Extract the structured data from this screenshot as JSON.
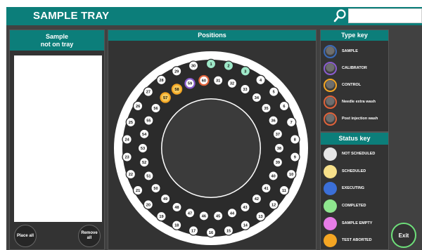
{
  "app": {
    "title": "SAMPLE TRAY"
  },
  "search": {
    "value": "",
    "placeholder": "",
    "icon": "search-icon"
  },
  "sample_panel": {
    "header": "Sample\nnot on tray",
    "place_all_label": "Place all",
    "remove_all_label": "Remove\nall"
  },
  "positions_panel": {
    "header": "Positions",
    "outer_ring": [
      {
        "label": "1",
        "status": "completed"
      },
      {
        "label": "2",
        "status": "completed"
      },
      {
        "label": "3",
        "status": "completed"
      },
      {
        "label": "4",
        "status": "not_scheduled"
      },
      {
        "label": "5",
        "status": "not_scheduled"
      },
      {
        "label": "6",
        "status": "not_scheduled"
      },
      {
        "label": "7",
        "status": "not_scheduled"
      },
      {
        "label": "8",
        "status": "not_scheduled"
      },
      {
        "label": "9",
        "status": "not_scheduled"
      },
      {
        "label": "10",
        "status": "not_scheduled"
      },
      {
        "label": "11",
        "status": "not_scheduled"
      },
      {
        "label": "12",
        "status": "not_scheduled"
      },
      {
        "label": "13",
        "status": "not_scheduled"
      },
      {
        "label": "14",
        "status": "not_scheduled"
      },
      {
        "label": "15",
        "status": "not_scheduled"
      },
      {
        "label": "16",
        "status": "not_scheduled"
      },
      {
        "label": "17",
        "status": "not_scheduled"
      },
      {
        "label": "18",
        "status": "not_scheduled"
      },
      {
        "label": "19",
        "status": "not_scheduled"
      },
      {
        "label": "20",
        "status": "not_scheduled"
      },
      {
        "label": "21",
        "status": "not_scheduled"
      },
      {
        "label": "22",
        "status": "not_scheduled"
      },
      {
        "label": "23",
        "status": "not_scheduled"
      },
      {
        "label": "24",
        "status": "not_scheduled"
      },
      {
        "label": "25",
        "status": "not_scheduled"
      },
      {
        "label": "26",
        "status": "not_scheduled"
      },
      {
        "label": "27",
        "status": "not_scheduled"
      },
      {
        "label": "28",
        "status": "not_scheduled"
      },
      {
        "label": "29",
        "status": "not_scheduled"
      },
      {
        "label": "30",
        "status": "not_scheduled"
      }
    ],
    "inner_ring": [
      {
        "label": "31",
        "status": "not_scheduled"
      },
      {
        "label": "32",
        "status": "not_scheduled"
      },
      {
        "label": "33",
        "status": "not_scheduled"
      },
      {
        "label": "34",
        "status": "not_scheduled"
      },
      {
        "label": "35",
        "status": "not_scheduled"
      },
      {
        "label": "36",
        "status": "not_scheduled"
      },
      {
        "label": "37",
        "status": "not_scheduled"
      },
      {
        "label": "38",
        "status": "not_scheduled"
      },
      {
        "label": "39",
        "status": "not_scheduled"
      },
      {
        "label": "40",
        "status": "not_scheduled"
      },
      {
        "label": "41",
        "status": "not_scheduled"
      },
      {
        "label": "42",
        "status": "not_scheduled"
      },
      {
        "label": "43",
        "status": "not_scheduled"
      },
      {
        "label": "44",
        "status": "not_scheduled"
      },
      {
        "label": "45",
        "status": "not_scheduled"
      },
      {
        "label": "46",
        "status": "not_scheduled"
      },
      {
        "label": "47",
        "status": "not_scheduled"
      },
      {
        "label": "48",
        "status": "not_scheduled"
      },
      {
        "label": "49",
        "status": "not_scheduled"
      },
      {
        "label": "50",
        "status": "not_scheduled"
      },
      {
        "label": "51",
        "status": "not_scheduled"
      },
      {
        "label": "52",
        "status": "not_scheduled"
      },
      {
        "label": "53",
        "status": "not_scheduled"
      },
      {
        "label": "54",
        "status": "not_scheduled"
      },
      {
        "label": "55",
        "status": "not_scheduled"
      },
      {
        "label": "56",
        "status": "not_scheduled"
      },
      {
        "label": "57",
        "status": "test_aborted",
        "ring": "#f5a623"
      },
      {
        "label": "58",
        "status": "test_aborted",
        "ring": "#f5a623"
      },
      {
        "label": "59",
        "status": "not_scheduled",
        "ring": "#8a5ccf"
      },
      {
        "label": "60",
        "status": "not_scheduled",
        "ring": "#e0623a"
      }
    ]
  },
  "type_key": {
    "header": "Type key",
    "items": [
      {
        "label": "SAMPLE",
        "ring": "#3a6ab8"
      },
      {
        "label": "CALIBRATOR",
        "ring": "#8a5ccf"
      },
      {
        "label": "CONTROL",
        "ring": "#f5a623"
      },
      {
        "label": "Needle extra wash",
        "ring": "#e0623a"
      },
      {
        "label": "Post injection wash",
        "ring": "#e0623a"
      }
    ]
  },
  "status_key": {
    "header": "Status key",
    "items": [
      {
        "label": "NOT SCHEDULED",
        "color": "#e6e6e6"
      },
      {
        "label": "SCHEDULED",
        "color": "#f7e08a"
      },
      {
        "label": "EXECUTING",
        "color": "#3b6fd8"
      },
      {
        "label": "COMPLETED",
        "color": "#8ee68e"
      },
      {
        "label": "SAMPLE EMPTY",
        "color": "#e87de8"
      },
      {
        "label": "TEST ABORTED",
        "color": "#f5a623"
      }
    ]
  },
  "exit_label": "Exit",
  "colors": {
    "accent": "#0c7e7a",
    "background": "#414141",
    "panel": "#333333",
    "not_scheduled": "#ffffff",
    "completed": "#9ee8c8",
    "test_aborted": "#f5c85a",
    "exit_ring": "#6ee07a"
  }
}
